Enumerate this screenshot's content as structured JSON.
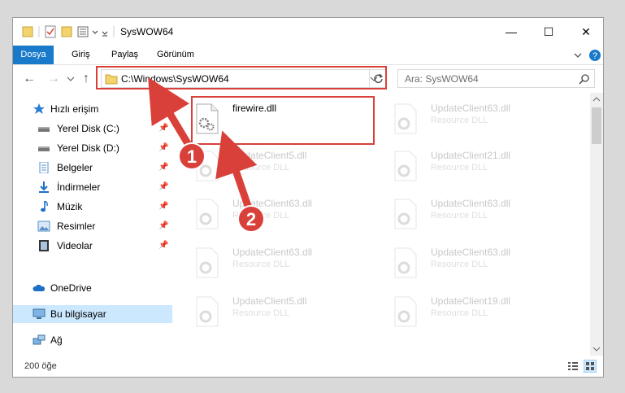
{
  "window": {
    "title": "SysWOW64",
    "controls": [
      "—",
      "☐",
      "✕"
    ]
  },
  "ribbon": {
    "tabs": [
      "Dosya",
      "Giriş",
      "Paylaş",
      "Görünüm"
    ]
  },
  "navigation": {
    "address": "C:\\Windows\\SysWOW64",
    "search_placeholder": "Ara: SysWOW64"
  },
  "sidebar": {
    "items": [
      {
        "label": "Hızlı erişim",
        "icon": "star-icon"
      },
      {
        "label": "Yerel Disk (C:)",
        "icon": "drive-icon",
        "pinned": true
      },
      {
        "label": "Yerel Disk (D:)",
        "icon": "drive-icon",
        "pinned": true
      },
      {
        "label": "Belgeler",
        "icon": "documents-icon",
        "pinned": true
      },
      {
        "label": "İndirmeler",
        "icon": "download-icon",
        "pinned": true
      },
      {
        "label": "Müzik",
        "icon": "music-icon",
        "pinned": true
      },
      {
        "label": "Resimler",
        "icon": "pictures-icon",
        "pinned": true
      },
      {
        "label": "Videolar",
        "icon": "videos-icon",
        "pinned": true
      },
      {
        "label": "OneDrive",
        "icon": "cloud-icon"
      },
      {
        "label": "Bu bilgisayar",
        "icon": "computer-icon",
        "selected": true
      },
      {
        "label": "Ağ",
        "icon": "network-icon"
      }
    ]
  },
  "files": {
    "highlighted": {
      "name": "firewire.dll",
      "type": ""
    },
    "items": [
      {
        "name": "UpdateClient63.dll",
        "type": "Resource DLL"
      },
      {
        "name": "UpdateClient5.dll",
        "type": "Resource DLL"
      },
      {
        "name": "UpdateClient21.dll",
        "type": "Resource DLL"
      },
      {
        "name": "UpdateClient63.dll",
        "type": "Resource DLL"
      },
      {
        "name": "UpdateClient63.dll",
        "type": "Resource DLL"
      },
      {
        "name": "UpdateClient63.dll",
        "type": "Resource DLL"
      },
      {
        "name": "UpdateClient63.dll",
        "type": "Resource DLL"
      },
      {
        "name": "UpdateClient5.dll",
        "type": "Resource DLL"
      },
      {
        "name": "UpdateClient19.dll",
        "type": "Resource DLL"
      }
    ]
  },
  "status": {
    "count": "200 öğe"
  },
  "annotations": {
    "step1": "1",
    "step2": "2",
    "color": "#d9403a"
  }
}
